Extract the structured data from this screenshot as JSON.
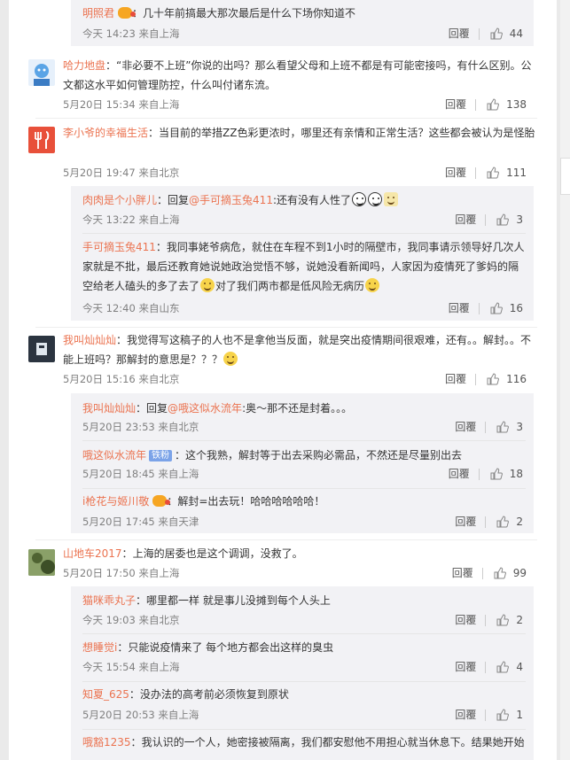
{
  "actions": {
    "reply_label": "回覆"
  },
  "comments": [
    {
      "replies": [
        {
          "user": "明照君",
          "sep": "：",
          "text": "几十年前搞最大那次最后是什么下场你知道不",
          "time": "今天 14:23 来自上海",
          "likes": "44"
        }
      ]
    },
    {
      "user": "哈力地盘",
      "sep": "：",
      "text": "“非必要不上班”你说的出吗？那么看望父母和上班不都是有可能密接吗，有什么区别。公文都这水平如何管理防控，什么叫付诸东流。",
      "time": "5月20日 15:34 来自上海",
      "likes": "138"
    },
    {
      "user": "李小爷的幸福生活",
      "sep": "：",
      "text": "当目前的举措ZZ色彩更浓时，哪里还有亲情和正常生活？这些都会被认为是怪胎",
      "time": "5月20日 19:47 来自北京",
      "likes": "111",
      "replies": [
        {
          "user": "肉肉是个小胖儿",
          "sep": "：",
          "pre": "回复",
          "mention": "@手可摘玉兔411",
          "text": ":还有没有人性了",
          "time": "今天 13:22 来自上海",
          "likes": "3"
        },
        {
          "user": "手可摘玉兔411",
          "sep": "：",
          "text": "我同事姥爷病危，就住在车程不到1小时的隔壁市，我同事请示领导好几次人家就是不批，最后还教育她说她政治觉悟不够，说她没看新闻吗，人家因为疫情死了爹妈的隔空给老人磕头的多了去了",
          "text_after": "对了我们两市都是低风险无病历",
          "time": "今天 12:40 来自山东",
          "likes": "16"
        }
      ]
    },
    {
      "user": "我叫灿灿灿",
      "sep": "：",
      "text": "我觉得写这稿子的人也不是拿他当反面，就是突出疫情期间很艰难，还有。。解封。。不能上班吗？那解封的意思是？？？",
      "time": "5月20日 15:16 来自北京",
      "likes": "116",
      "replies": [
        {
          "user": "我叫灿灿灿",
          "sep": "：",
          "pre": "回复",
          "mention": "@哦这似水流年",
          "text": ":奥～那不还是封着。。。",
          "time": "5月20日 23:53 来自北京",
          "likes": "3"
        },
        {
          "user": "哦这似水流年",
          "badge": "铁粉",
          "sep": "：",
          "text": "这个我熟，解封等于出去采购必需品，不然还是尽量别出去",
          "time": "5月20日 18:45 来自上海",
          "likes": "18"
        },
        {
          "user": "i枪花与姬川敬",
          "sep": "：",
          "text": "解封=出去玩！哈哈哈哈哈哈！",
          "time": "5月20日 17:45 来自天津",
          "likes": "2"
        }
      ]
    },
    {
      "user": "山地车2017",
      "sep": "：",
      "text": "上海的居委也是这个调调，没救了。",
      "time": "5月20日 17:50 来自上海",
      "likes": "99",
      "replies": [
        {
          "user": "猫咪乖丸子",
          "sep": "：",
          "text": "哪里都一样 就是事儿没摊到每个人头上",
          "time": "今天 19:03 来自北京",
          "likes": "2"
        },
        {
          "user": "想睡觉i",
          "sep": "：",
          "text": "只能说疫情来了 每个地方都会出这样的臭虫",
          "time": "今天 15:54 来自上海",
          "likes": "4"
        },
        {
          "user": "知夏_625",
          "sep": "：",
          "text": "没办法的高考前必须恢复到原状",
          "time": "5月20日 20:53 来自上海",
          "likes": "1"
        },
        {
          "user": "哦豁1235",
          "sep": "：",
          "text": "我认识的一个人，她密接被隔离，我们都安慰他不用担心就当休息下。结果她开始"
        }
      ]
    }
  ]
}
